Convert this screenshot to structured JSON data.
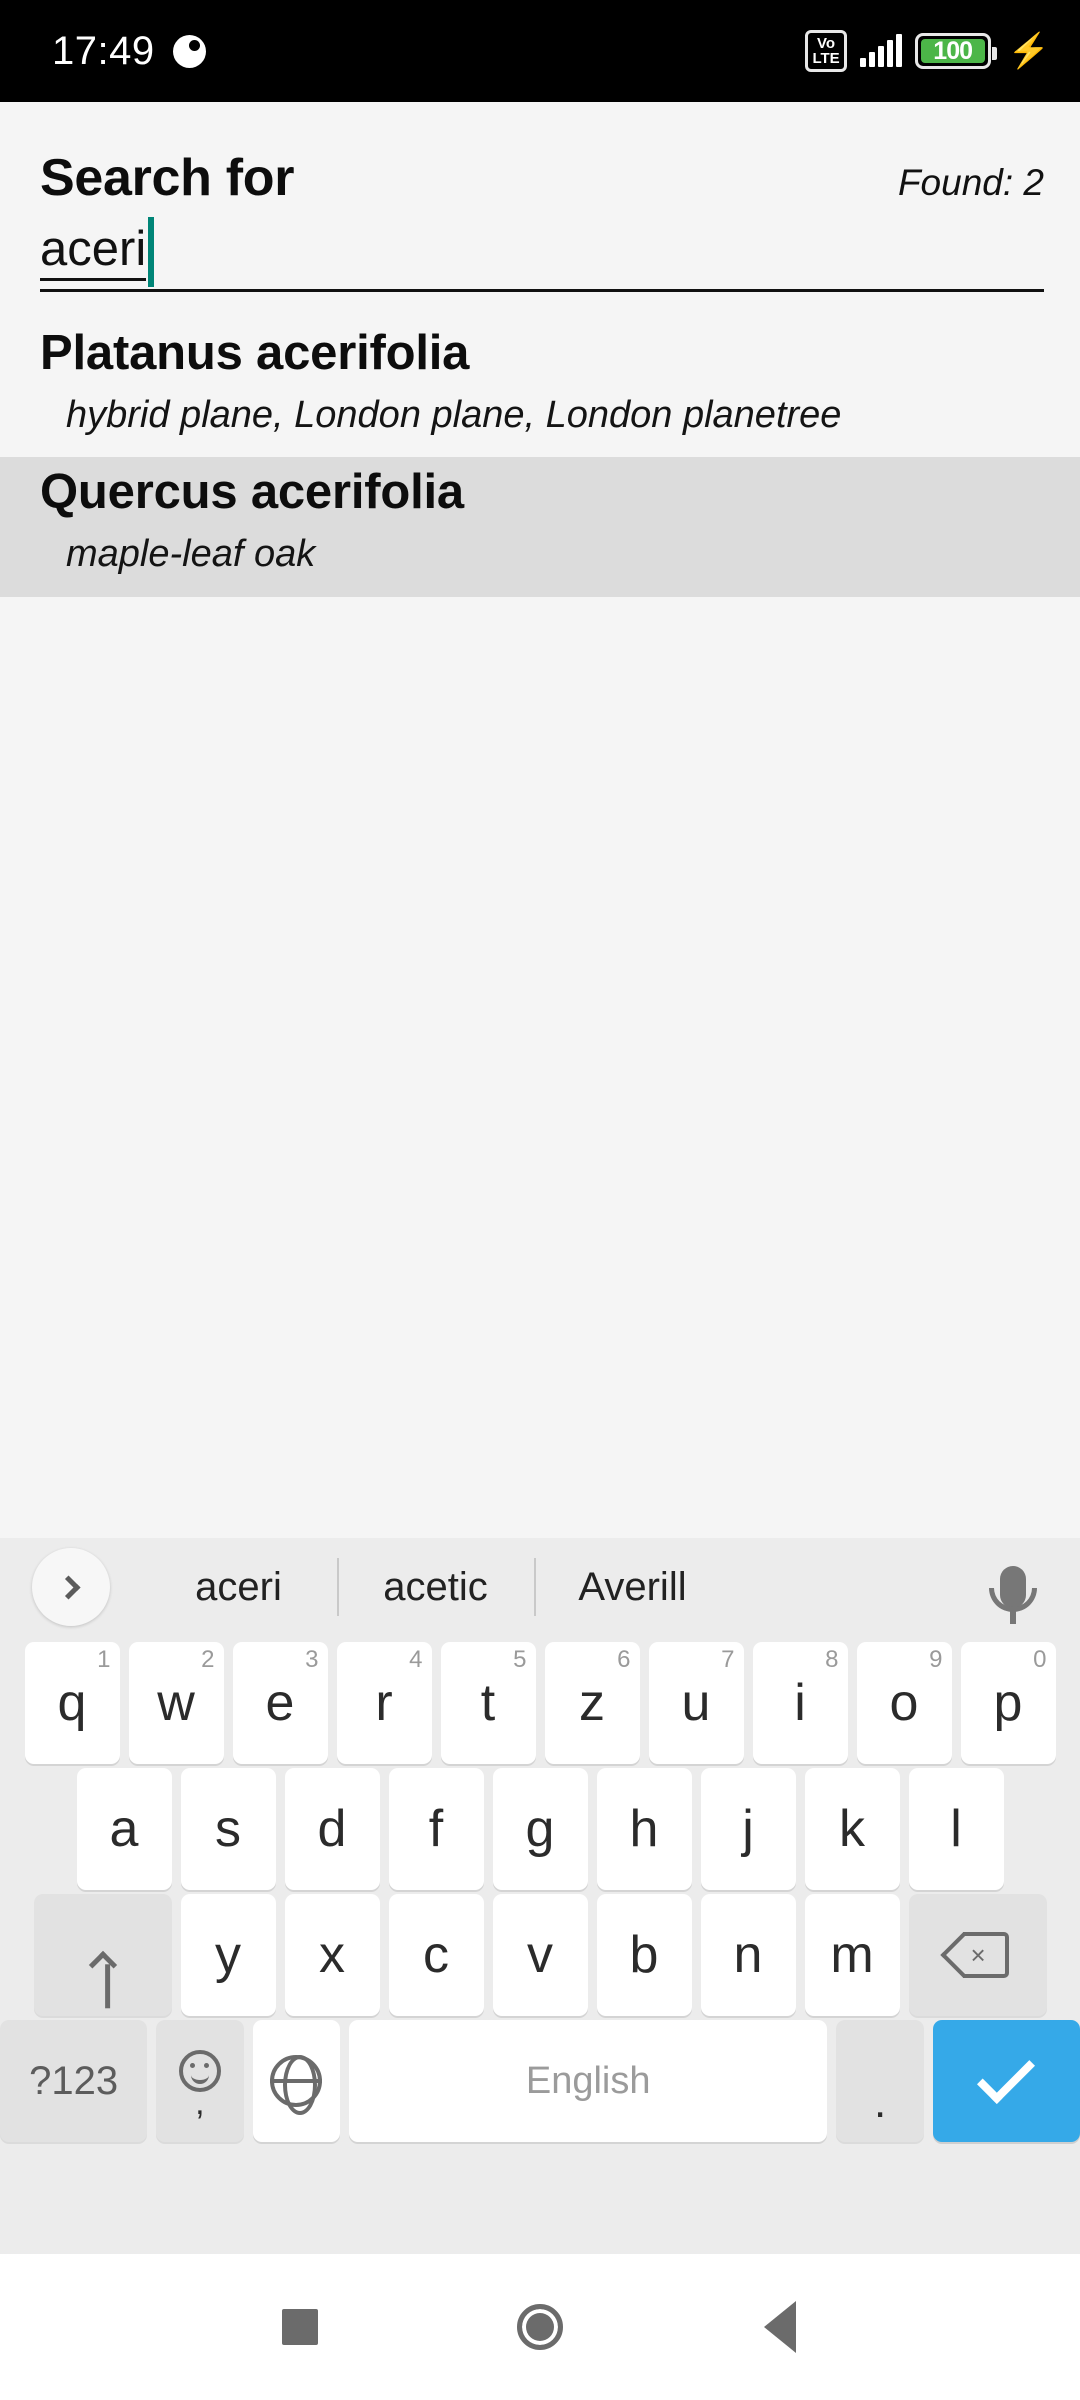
{
  "status_bar": {
    "clock": "17:49",
    "notification_icon": "moon-icon",
    "volte_top": "Vo",
    "volte_bottom": "LTE",
    "signal_icon": "signal-bars-icon",
    "battery_percent": "100",
    "charging_icon": "lightning-bolt-icon",
    "battery_color": "#4cb648"
  },
  "header": {
    "title": "Search for",
    "found_label": "Found: 2"
  },
  "search": {
    "value": "aceri",
    "caret_color": "#008577"
  },
  "results": [
    {
      "name": "Platanus acerifolia",
      "common_names": "hybrid plane, London plane, London planetree",
      "selected": false
    },
    {
      "name": "Quercus acerifolia",
      "common_names": "maple-leaf oak",
      "selected": true
    }
  ],
  "keyboard": {
    "expand_icon": "chevron-right-icon",
    "suggestions": [
      "aceri",
      "acetic",
      "Averill"
    ],
    "mic_icon": "microphone-icon",
    "row1": [
      {
        "label": "q",
        "num": "1"
      },
      {
        "label": "w",
        "num": "2"
      },
      {
        "label": "e",
        "num": "3"
      },
      {
        "label": "r",
        "num": "4"
      },
      {
        "label": "t",
        "num": "5"
      },
      {
        "label": "z",
        "num": "6"
      },
      {
        "label": "u",
        "num": "7"
      },
      {
        "label": "i",
        "num": "8"
      },
      {
        "label": "o",
        "num": "9"
      },
      {
        "label": "p",
        "num": "0"
      }
    ],
    "row2": [
      {
        "label": "a"
      },
      {
        "label": "s"
      },
      {
        "label": "d"
      },
      {
        "label": "f"
      },
      {
        "label": "g"
      },
      {
        "label": "h"
      },
      {
        "label": "j"
      },
      {
        "label": "k"
      },
      {
        "label": "l"
      }
    ],
    "row3_letters": [
      {
        "label": "y"
      },
      {
        "label": "x"
      },
      {
        "label": "c"
      },
      {
        "label": "v"
      },
      {
        "label": "b"
      },
      {
        "label": "n"
      },
      {
        "label": "m"
      }
    ],
    "shift_icon": "shift-arrow-up-icon",
    "backspace_icon": "backspace-icon",
    "symbols_label": "?123",
    "emoji_icon": "smiley-icon",
    "comma_label": ",",
    "globe_icon": "globe-language-icon",
    "space_label": "English",
    "period_label": ".",
    "enter_icon": "checkmark-icon",
    "enter_color": "#35a9e8"
  },
  "navbar": {
    "recents_icon": "square-recents-icon",
    "home_icon": "circle-home-icon",
    "back_icon": "triangle-back-icon"
  }
}
